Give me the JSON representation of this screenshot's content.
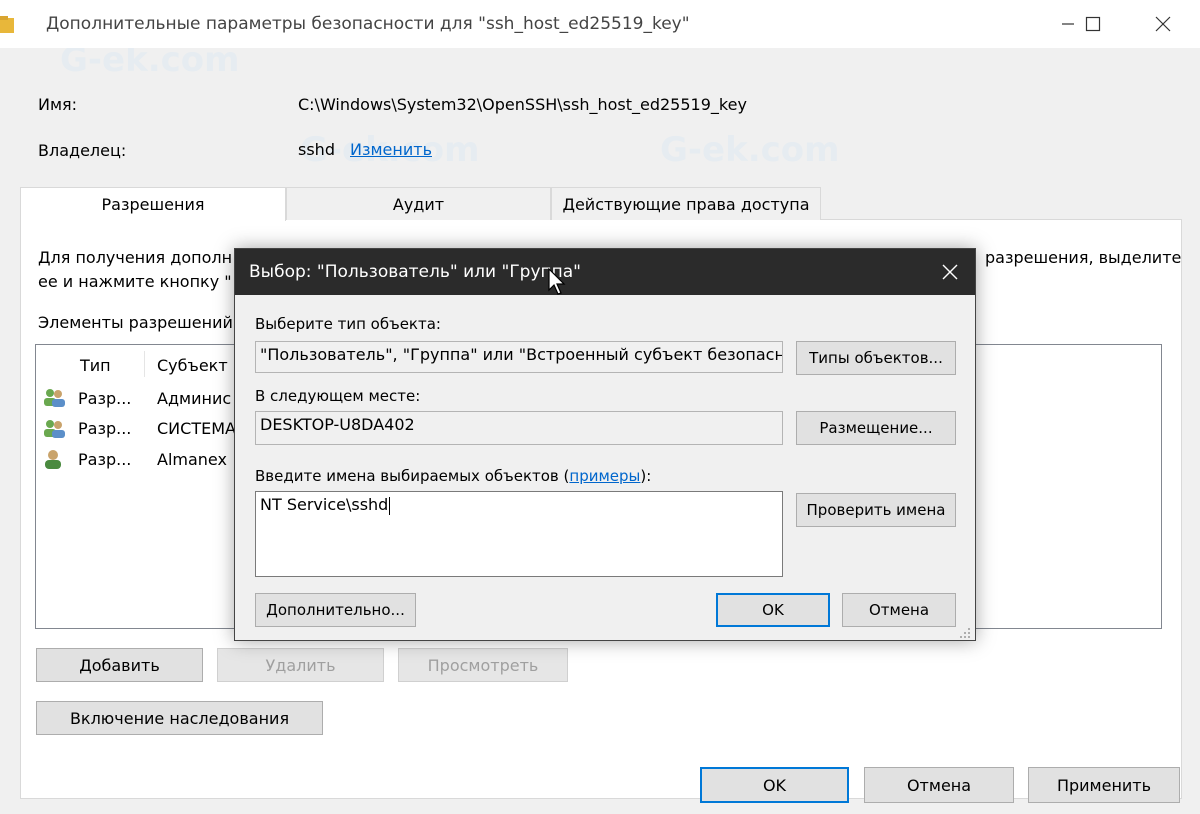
{
  "window": {
    "title": "Дополнительные параметры безопасности  для \"ssh_host_ed25519_key\"",
    "controls": {
      "minimize": "—",
      "maximize": "☐",
      "close": "✕"
    }
  },
  "info": {
    "name_label": "Имя:",
    "name_value": "C:\\Windows\\System32\\OpenSSH\\ssh_host_ed25519_key",
    "owner_label": "Владелец:",
    "owner_value": "sshd",
    "owner_change_link": "Изменить"
  },
  "tabs": [
    {
      "label": "Разрешения",
      "selected": true
    },
    {
      "label": "Аудит",
      "selected": false
    },
    {
      "label": "Действующие права доступа",
      "selected": false
    }
  ],
  "permissions_tab": {
    "description_line1_start": "Для получения дополн",
    "description_line1_end": "разрешения, выделите",
    "description_line2": "ее и нажмите кнопку \"",
    "entries_label": "Элементы разрешений",
    "columns": [
      "Тип",
      "Субъект"
    ],
    "rows": [
      {
        "type": "Разр...",
        "subject": "Админис",
        "icon": "group-users-icon"
      },
      {
        "type": "Разр...",
        "subject": "СИСТЕМА",
        "icon": "group-users-icon"
      },
      {
        "type": "Разр...",
        "subject": "Almanex",
        "icon": "user-icon"
      }
    ],
    "buttons": {
      "add": "Добавить",
      "remove": "Удалить",
      "view": "Просмотреть"
    },
    "inheritance_button": "Включение наследования"
  },
  "footer_buttons": {
    "ok": "OK",
    "cancel": "Отмена",
    "apply": "Применить"
  },
  "dialog": {
    "title": "Выбор: \"Пользователь\" или \"Группа\"",
    "close": "✕",
    "object_type_label": "Выберите тип объекта:",
    "object_type_value": "\"Пользователь\", \"Группа\" или \"Встроенный субъект безопаснос",
    "object_types_button": "Типы объектов...",
    "location_label": "В следующем месте:",
    "location_value": "DESKTOP-U8DA402",
    "locations_button": "Размещение...",
    "names_label_prefix": "Введите имена выбираемых объектов (",
    "names_label_link": "примеры",
    "names_label_suffix": "):",
    "names_value": "NT Service\\sshd",
    "check_names_button": "Проверить имена",
    "advanced_button": "Дополнительно...",
    "ok_button": "OK",
    "cancel_button": "Отмена"
  },
  "watermark": "G-ek.com",
  "colors": {
    "accent": "#0078d7",
    "link": "#0066cc",
    "dialog_titlebar": "#2b2b2b"
  }
}
